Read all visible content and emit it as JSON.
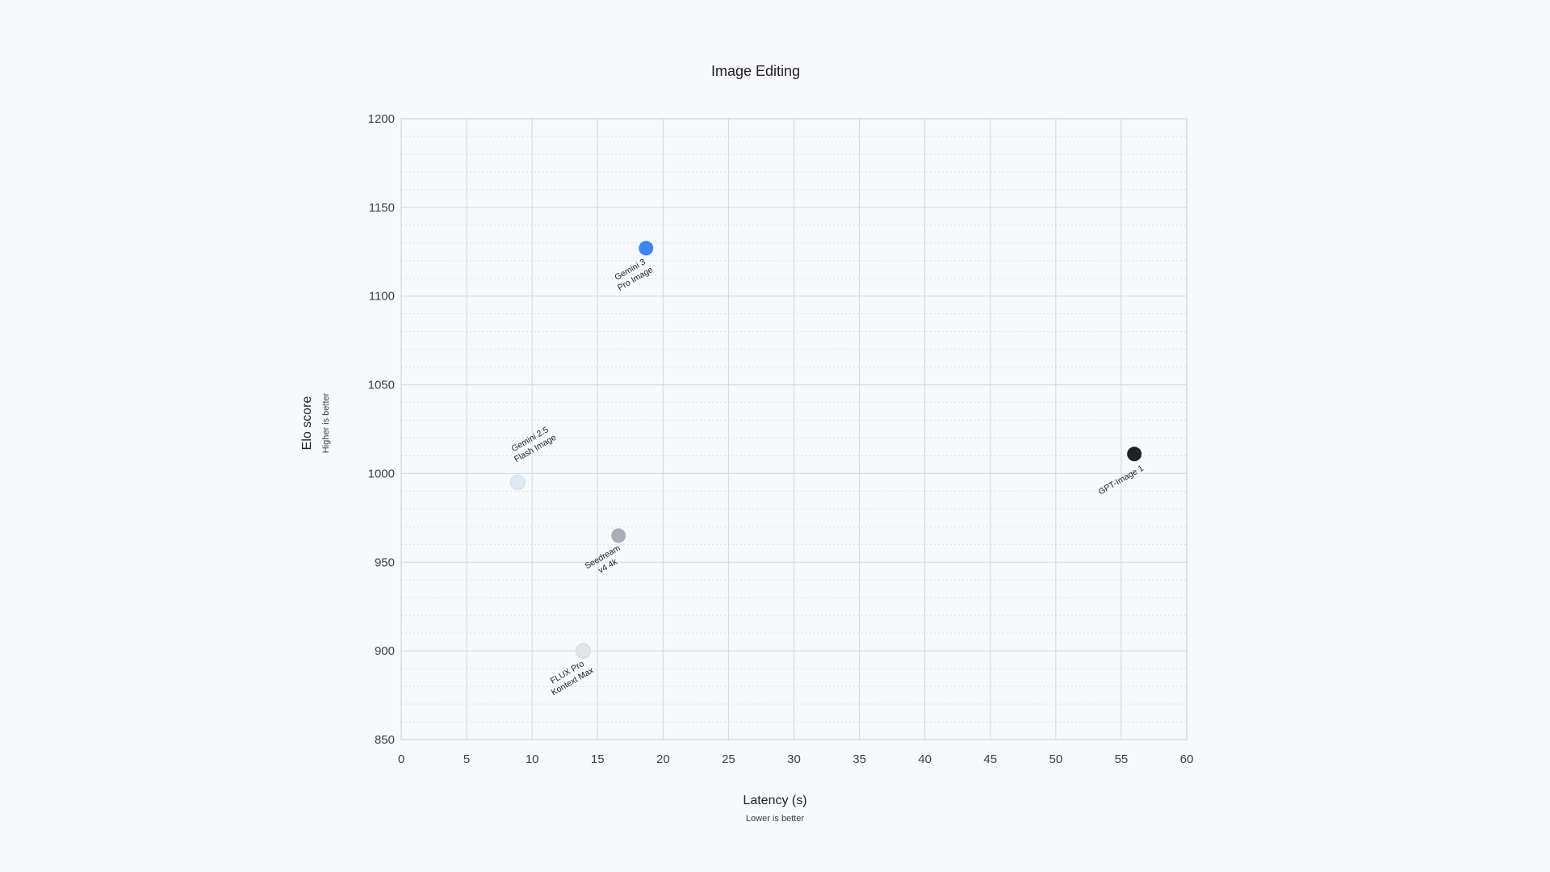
{
  "chart_data": {
    "type": "scatter",
    "title": "Image Editing",
    "xlabel": "Latency (s)",
    "xlabel_sub": "Lower is better",
    "ylabel": "Elo score",
    "ylabel_sub": "Higher is better",
    "xlim": [
      0,
      60
    ],
    "ylim": [
      850,
      1200
    ],
    "xticks": [
      0,
      5,
      10,
      15,
      20,
      25,
      30,
      35,
      40,
      45,
      50,
      55,
      60
    ],
    "yticks": [
      850,
      900,
      950,
      1000,
      1050,
      1100,
      1150,
      1200
    ],
    "grid": true,
    "points": [
      {
        "label_lines": [
          "Gemini 3",
          "Pro Image"
        ],
        "x": 18.7,
        "y": 1127,
        "color": "#3b86f0",
        "label_pos": "below"
      },
      {
        "label_lines": [
          "Gemini 2.5",
          "Flash Image"
        ],
        "x": 8.9,
        "y": 995,
        "color": "#ddebf7",
        "label_pos": "above"
      },
      {
        "label_lines": [
          "Seedream",
          "v4 4k"
        ],
        "x": 16.6,
        "y": 965,
        "color": "#a9afb8",
        "label_pos": "below"
      },
      {
        "label_lines": [
          "FLUX Pro",
          "Kontext Max"
        ],
        "x": 13.9,
        "y": 900,
        "color": "#e2e4e7",
        "label_pos": "below"
      },
      {
        "label_lines": [
          "GPT-Image 1"
        ],
        "x": 56,
        "y": 1011,
        "color": "#1f2124",
        "label_pos": "below"
      }
    ]
  }
}
